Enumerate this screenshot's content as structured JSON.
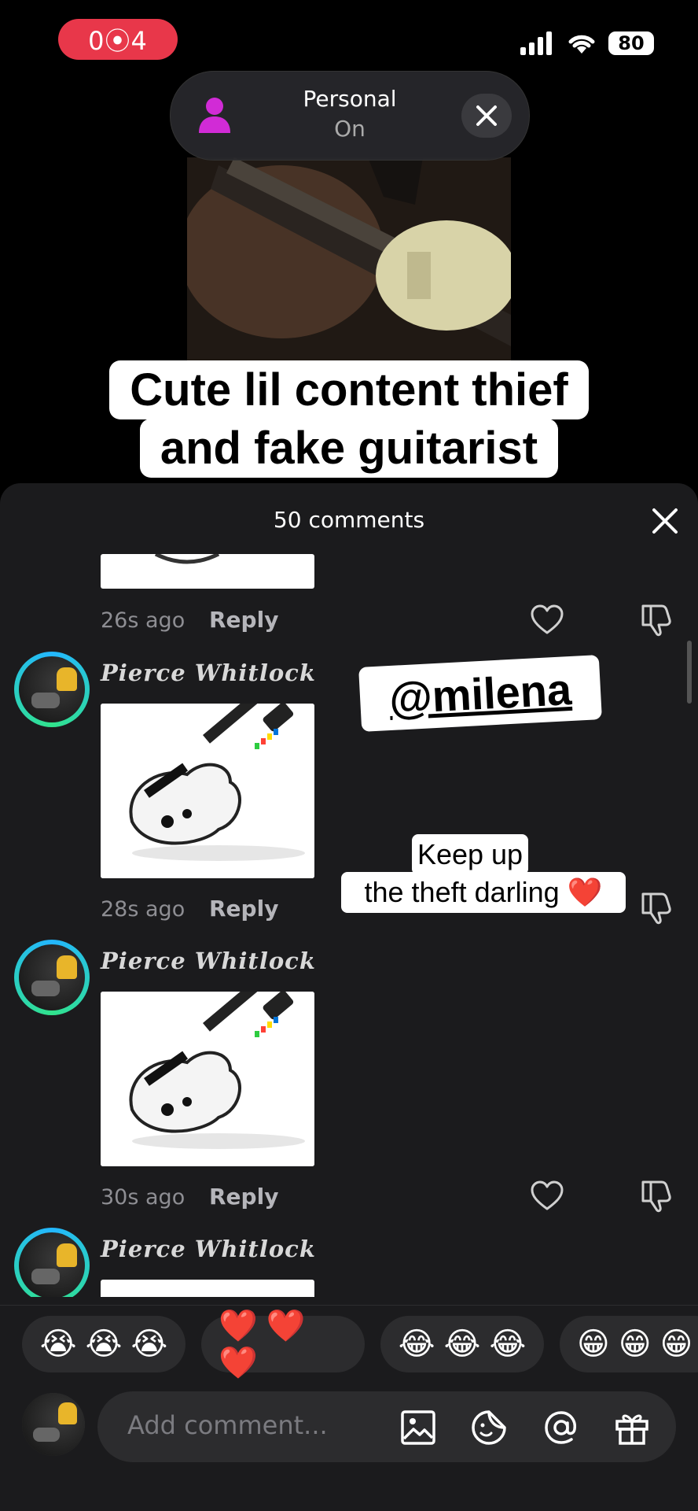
{
  "status_bar": {
    "recording_time": "0⦿4",
    "battery": "80"
  },
  "focus_banner": {
    "title": "Personal",
    "status": "On"
  },
  "video_caption": {
    "line1": "Cute lil content thief",
    "line2": "and fake guitarist"
  },
  "comments_sheet": {
    "title": "50 comments",
    "comments": [
      {
        "time": "26s ago",
        "reply": "Reply"
      },
      {
        "user": "Pierce Whitlock",
        "time": "28s ago",
        "reply": "Reply"
      },
      {
        "user": "Pierce Whitlock",
        "time": "30s ago",
        "reply": "Reply"
      },
      {
        "user": "Pierce Whitlock"
      }
    ]
  },
  "stickers": {
    "mention": "@milena",
    "message_line1": "Keep up",
    "message_line2": "the theft darling ❤️"
  },
  "emoji_bar": {
    "groups": [
      "😭 😭 😭",
      "❤️ ❤️ ❤️",
      "😂 😂 😂",
      "😁 😁 😁"
    ]
  },
  "comment_input": {
    "placeholder": "Add comment..."
  },
  "colors": {
    "record_pill": "#e8374a",
    "sheet_bg": "#1b1b1d",
    "focus_icon": "#d12bd6",
    "avatar_ring": "#23b7ff"
  }
}
